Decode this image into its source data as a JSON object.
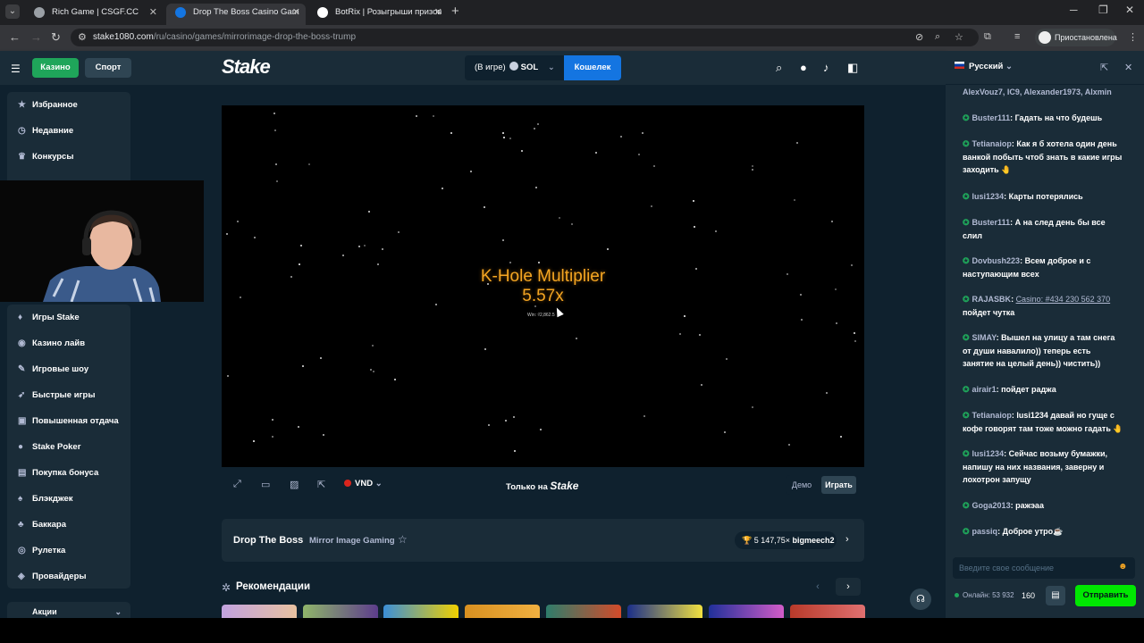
{
  "browser": {
    "tabs": [
      {
        "title": "Rich Game | CSGF.CC"
      },
      {
        "title": "Drop The Boss Casino Gam"
      },
      {
        "title": "BotRix | Розыгрыши призов"
      }
    ],
    "url_host": "stake1080.com",
    "url_path": "/ru/casino/games/mirrorimage-drop-the-boss-trump",
    "profile_label": "Приостановлена"
  },
  "header": {
    "casino_label": "Казино",
    "sport_label": "Спорт",
    "logo": "Stake",
    "wallet_status": "(В игре)",
    "currency": "SOL",
    "wallet_label": "Кошелек"
  },
  "sidebar": {
    "top_items": [
      {
        "label": "Избранное",
        "icon": "star-icon"
      },
      {
        "label": "Недавние",
        "icon": "clock-icon"
      },
      {
        "label": "Конкурсы",
        "icon": "trophy-icon"
      }
    ],
    "items": [
      {
        "label": "Игры Stake",
        "icon": "stake-icon"
      },
      {
        "label": "Казино лайв",
        "icon": "live-icon"
      },
      {
        "label": "Игровые шоу",
        "icon": "show-icon"
      },
      {
        "label": "Быстрые игры",
        "icon": "rocket-icon"
      },
      {
        "label": "Повышенная отдача",
        "icon": "percent-icon"
      },
      {
        "label": "Stake Poker",
        "icon": "poker-icon"
      },
      {
        "label": "Покупка бонуса",
        "icon": "bonus-icon"
      },
      {
        "label": "Блэкджек",
        "icon": "cards-icon"
      },
      {
        "label": "Баккара",
        "icon": "baccarat-icon"
      },
      {
        "label": "Рулетка",
        "icon": "roulette-icon"
      },
      {
        "label": "Провайдеры",
        "icon": "provider-icon"
      }
    ],
    "promo_label": "Акции"
  },
  "game": {
    "overlay_line1": "K-Hole Multiplier",
    "overlay_line2": "5.57x",
    "win_text": "Win: ₫2,862.5",
    "currency": "VND",
    "only_on": "Только на",
    "only_on_brand": "Stake",
    "demo_label": "Демо",
    "play_label": "Играть"
  },
  "info": {
    "title": "Drop The Boss",
    "provider": "Mirror Image Gaming",
    "record_value": "5 147,75×",
    "record_user": "bigmeech2"
  },
  "recommendations": {
    "title": "Рекомендации"
  },
  "chat": {
    "language": "Русский",
    "messages": [
      {
        "user": "",
        "text": "AlexVouz7, IC9, Alexander1973, Alxmin"
      },
      {
        "user": "Buster111",
        "text": "Гадать на что будешь"
      },
      {
        "user": "Tetianaiop",
        "text": "Как я б хотела один день ванкой побыть чтоб знать в какие игры заходить 🤚"
      },
      {
        "user": "lusi1234",
        "text": "Карты потерялись"
      },
      {
        "user": "Buster111",
        "text": "А на след день бы все слил"
      },
      {
        "user": "Dovbush223",
        "text": "Всем доброе и с наступающим всех"
      },
      {
        "user": "RAJASBK",
        "link": "Casino: #434 230 562 370",
        "text": "пойдет чутка"
      },
      {
        "user": "SIMAY",
        "text": "Вышел на улицу а там снега от души навалило)) теперь есть занятие на целый день)) чистить))"
      },
      {
        "user": "airair1",
        "text": "пойдет раджа"
      },
      {
        "user": "Tetianaiop",
        "text": "lusi1234 давай но гуще с кофе говорят там тоже можно гадать 🤚"
      },
      {
        "user": "lusi1234",
        "text": "Сейчас возьму бумажки, напишу на них названия, заверну и лохотрон запущу"
      },
      {
        "user": "Goga2013",
        "text": "ражэаа"
      },
      {
        "user": "passiq",
        "text": "Доброе утро☕"
      }
    ],
    "input_placeholder": "Введите свое сообщение",
    "online_label": "Онлайн: 53 932",
    "count": "160",
    "send_label": "Отправить"
  }
}
